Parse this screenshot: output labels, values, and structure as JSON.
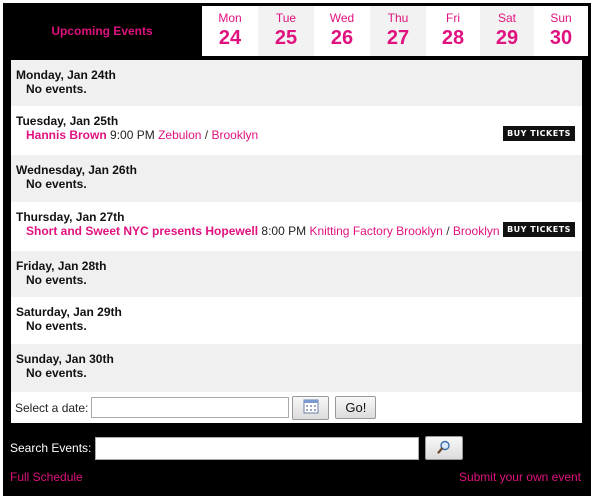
{
  "header": {
    "title": "Upcoming Events",
    "days": [
      {
        "name": "Mon",
        "num": "24"
      },
      {
        "name": "Tue",
        "num": "25"
      },
      {
        "name": "Wed",
        "num": "26"
      },
      {
        "name": "Thu",
        "num": "27"
      },
      {
        "name": "Fri",
        "num": "28"
      },
      {
        "name": "Sat",
        "num": "29"
      },
      {
        "name": "Sun",
        "num": "30"
      }
    ]
  },
  "schedule": {
    "no_events": "No events.",
    "buy_label": "BUY TICKETS",
    "sep": "/",
    "days": [
      {
        "heading": "Monday, Jan 24th"
      },
      {
        "heading": "Tuesday, Jan 25th",
        "event": {
          "name": "Hannis Brown",
          "time": "9:00 PM",
          "venue": "Zebulon",
          "city": "Brooklyn"
        }
      },
      {
        "heading": "Wednesday, Jan 26th"
      },
      {
        "heading": "Thursday, Jan 27th",
        "event": {
          "name": "Short and Sweet NYC presents Hopewell",
          "time": "8:00 PM",
          "venue": "Knitting Factory Brooklyn",
          "city": "Brooklyn"
        }
      },
      {
        "heading": "Friday, Jan 28th"
      },
      {
        "heading": "Saturday, Jan 29th"
      },
      {
        "heading": "Sunday, Jan 30th"
      }
    ]
  },
  "date_select": {
    "label": "Select a date:",
    "value": "",
    "go_label": "Go!"
  },
  "search": {
    "label": "Search Events:",
    "value": ""
  },
  "footer": {
    "full_schedule": "Full Schedule",
    "submit": "Submit your own event"
  },
  "icons": {
    "calendar": "calendar-icon",
    "search": "magnifier-icon"
  },
  "colors": {
    "accent": "#e0127f",
    "background": "#000000",
    "row_alt": "#f0f0f0"
  }
}
